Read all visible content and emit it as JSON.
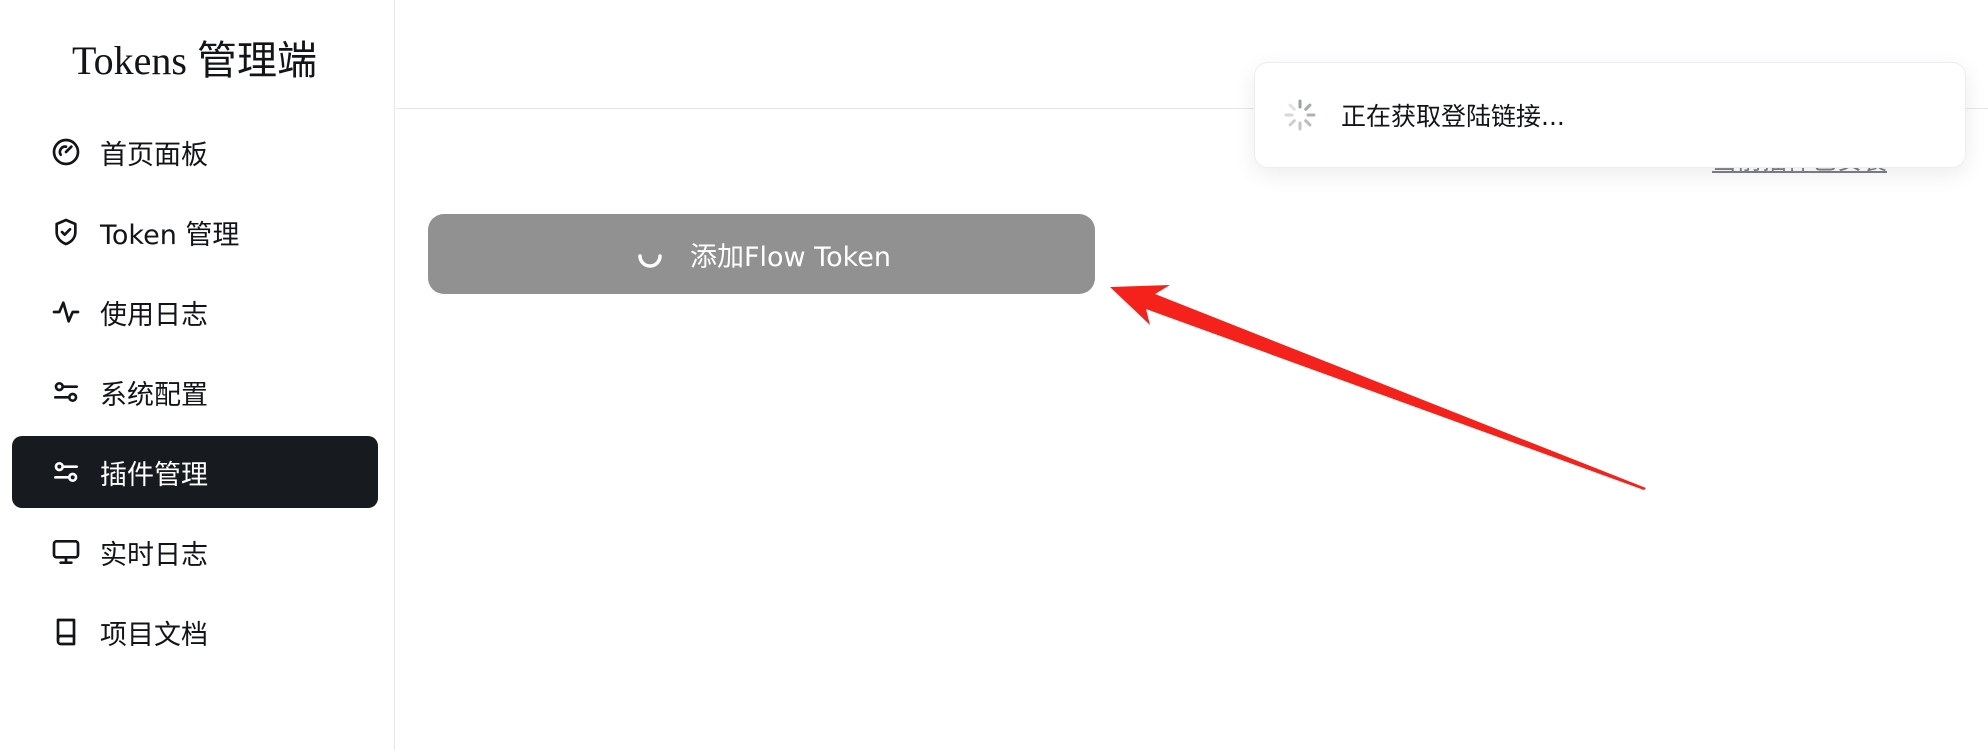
{
  "brand": {
    "title": "Tokens 管理端"
  },
  "sidebar": {
    "items": [
      {
        "label": "首页面板",
        "icon": "dashboard-gauge-icon",
        "active": false
      },
      {
        "label": "Token 管理",
        "icon": "shield-check-icon",
        "active": false
      },
      {
        "label": "使用日志",
        "icon": "activity-icon",
        "active": false
      },
      {
        "label": "系统配置",
        "icon": "settings-sliders-icon",
        "active": false
      },
      {
        "label": "插件管理",
        "icon": "settings-sliders-icon",
        "active": true
      },
      {
        "label": "实时日志",
        "icon": "monitor-icon",
        "active": false
      },
      {
        "label": "项目文档",
        "icon": "book-icon",
        "active": false
      }
    ]
  },
  "main": {
    "partially_hidden_link": "当前插件已安装",
    "add_button": {
      "label": "添加Flow Token",
      "loading": true
    }
  },
  "toast": {
    "message": "正在获取登陆链接...",
    "icon": "loading-spinner-icon"
  },
  "colors": {
    "active_nav_bg": "#171b1f",
    "button_bg": "#919191",
    "annotation_arrow": "#f5221b"
  }
}
